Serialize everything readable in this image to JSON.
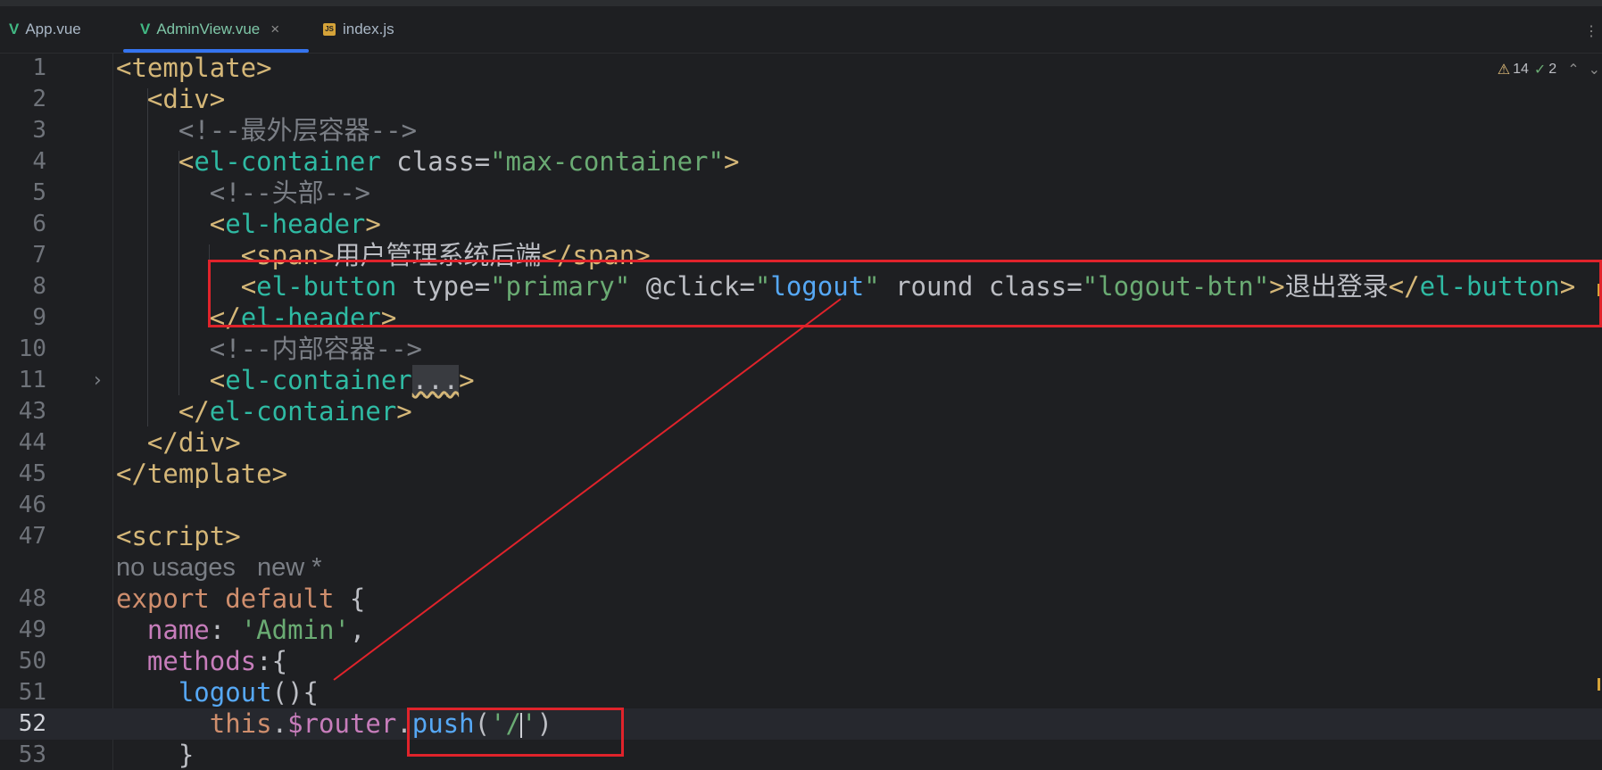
{
  "tabs": [
    {
      "label": "App.vue",
      "icon": "vue-icon",
      "active": false
    },
    {
      "label": "AdminView.vue",
      "icon": "vue-icon",
      "active": true
    },
    {
      "label": "index.js",
      "icon": "js-file-icon",
      "active": false
    }
  ],
  "tab_close_glyph": "×",
  "menu_glyph": "⋮",
  "inspection": {
    "warnings": "14",
    "typos": "2",
    "warn_glyph": "⚠",
    "typo_glyph": "✓",
    "up_glyph": "⌃",
    "down_glyph": "⌄"
  },
  "fold_glyph": "›",
  "inlay_hint": "no usages   new *",
  "lines": [
    {
      "n": "1",
      "tokens": [
        [
          "t-tag",
          "<template>"
        ]
      ]
    },
    {
      "n": "2",
      "tokens": [
        [
          "t-plain",
          "  "
        ],
        [
          "t-tag",
          "<div>"
        ]
      ]
    },
    {
      "n": "3",
      "tokens": [
        [
          "t-plain",
          "    "
        ],
        [
          "t-cmt",
          "<!--最外层容器-->"
        ]
      ]
    },
    {
      "n": "4",
      "tokens": [
        [
          "t-plain",
          "    "
        ],
        [
          "t-tag",
          "<"
        ],
        [
          "t-el",
          "el-container"
        ],
        [
          "t-plain",
          " "
        ],
        [
          "t-attr",
          "class"
        ],
        [
          "t-plain",
          "="
        ],
        [
          "t-str",
          "\"max-container\""
        ],
        [
          "t-tag",
          ">"
        ]
      ]
    },
    {
      "n": "5",
      "tokens": [
        [
          "t-plain",
          "      "
        ],
        [
          "t-cmt",
          "<!--头部-->"
        ]
      ]
    },
    {
      "n": "6",
      "tokens": [
        [
          "t-plain",
          "      "
        ],
        [
          "t-tag",
          "<"
        ],
        [
          "t-el",
          "el-header"
        ],
        [
          "t-tag",
          ">"
        ]
      ]
    },
    {
      "n": "7",
      "tokens": [
        [
          "t-plain",
          "        "
        ],
        [
          "t-tag",
          "<span>"
        ],
        [
          "t-plain",
          "用户管理系统后端"
        ],
        [
          "t-tag",
          "</span>"
        ]
      ]
    },
    {
      "n": "8",
      "tokens": [
        [
          "t-plain",
          "        "
        ],
        [
          "t-tag",
          "<"
        ],
        [
          "t-el",
          "el-button"
        ],
        [
          "t-plain",
          " "
        ],
        [
          "t-attr",
          "type"
        ],
        [
          "t-plain",
          "="
        ],
        [
          "t-str",
          "\"primary\""
        ],
        [
          "t-plain",
          " "
        ],
        [
          "t-attr",
          "@click"
        ],
        [
          "t-plain",
          "="
        ],
        [
          "t-str",
          "\""
        ],
        [
          "t-strb",
          "logout"
        ],
        [
          "t-str",
          "\""
        ],
        [
          "t-plain",
          " "
        ],
        [
          "t-attr",
          "round"
        ],
        [
          "t-plain",
          " "
        ],
        [
          "t-attr",
          "class"
        ],
        [
          "t-plain",
          "="
        ],
        [
          "t-str",
          "\"logout-btn\""
        ],
        [
          "t-tag",
          ">"
        ],
        [
          "t-plain",
          "退出登录"
        ],
        [
          "t-tag",
          "</"
        ],
        [
          "t-el",
          "el-button"
        ],
        [
          "t-tag",
          ">"
        ]
      ]
    },
    {
      "n": "9",
      "tokens": [
        [
          "t-plain",
          "      "
        ],
        [
          "t-tag",
          "</"
        ],
        [
          "t-el",
          "el-header"
        ],
        [
          "t-tag",
          ">"
        ]
      ]
    },
    {
      "n": "10",
      "tokens": [
        [
          "t-plain",
          "      "
        ],
        [
          "t-cmt",
          "<!--内部容器-->"
        ]
      ]
    },
    {
      "n": "11",
      "tokens": [
        [
          "t-plain",
          "      "
        ],
        [
          "t-tag",
          "<"
        ],
        [
          "t-el",
          "el-container"
        ],
        [
          "fold-ph",
          "..."
        ],
        [
          "t-tag",
          ">"
        ]
      ],
      "folded": true
    },
    {
      "n": "43",
      "tokens": [
        [
          "t-plain",
          "    "
        ],
        [
          "t-tag",
          "</"
        ],
        [
          "t-el",
          "el-container"
        ],
        [
          "t-tag",
          ">"
        ]
      ]
    },
    {
      "n": "44",
      "tokens": [
        [
          "t-plain",
          "  "
        ],
        [
          "t-tag",
          "</div>"
        ]
      ]
    },
    {
      "n": "45",
      "tokens": [
        [
          "t-tag",
          "</template>"
        ]
      ]
    },
    {
      "n": "46",
      "tokens": []
    },
    {
      "n": "47",
      "tokens": [
        [
          "t-tag",
          "<script>"
        ]
      ]
    },
    {
      "n": "",
      "inlay": true,
      "tokens": []
    },
    {
      "n": "48",
      "tokens": [
        [
          "t-kw",
          "export default"
        ],
        [
          "t-plain",
          " {"
        ]
      ]
    },
    {
      "n": "49",
      "tokens": [
        [
          "t-plain",
          "  "
        ],
        [
          "t-prop",
          "name"
        ],
        [
          "t-plain",
          ": "
        ],
        [
          "t-str",
          "'Admin'"
        ],
        [
          "t-plain",
          ","
        ]
      ]
    },
    {
      "n": "50",
      "tokens": [
        [
          "t-plain",
          "  "
        ],
        [
          "t-prop",
          "methods"
        ],
        [
          "t-plain",
          ":{"
        ]
      ]
    },
    {
      "n": "51",
      "tokens": [
        [
          "t-plain",
          "    "
        ],
        [
          "t-fn",
          "logout"
        ],
        [
          "t-plain",
          "(){"
        ]
      ]
    },
    {
      "n": "52",
      "current": true,
      "tokens": [
        [
          "t-plain",
          "      "
        ],
        [
          "t-kw",
          "this"
        ],
        [
          "t-plain",
          "."
        ],
        [
          "t-prop",
          "$router"
        ],
        [
          "t-plain",
          "."
        ],
        [
          "t-fn",
          "push"
        ],
        [
          "t-plain",
          "("
        ],
        [
          "t-str",
          "'/"
        ],
        [
          "caret",
          ""
        ],
        [
          "t-str",
          "'"
        ],
        [
          "t-plain",
          ")"
        ]
      ]
    },
    {
      "n": "53",
      "tokens": [
        [
          "t-plain",
          "    }"
        ]
      ]
    }
  ]
}
